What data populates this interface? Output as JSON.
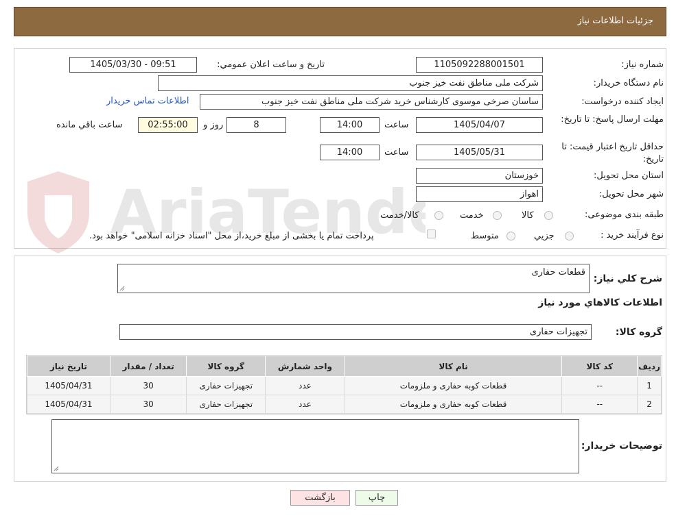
{
  "header": {
    "title": "جزئیات اطلاعات نیاز"
  },
  "fields": {
    "need_number_label": "شماره نیاز:",
    "need_number": "1105092288001501",
    "announce_label": "تاریخ و ساعت اعلان عمومي:",
    "announce_value": "1405/03/30 - 09:51",
    "buyer_label": "نام دستگاه خريدار:",
    "buyer_value": "شرکت ملی مناطق نفت خیز جنوب",
    "creator_label": "ايجاد کننده درخواست:",
    "creator_value": "ساسان صرخی موسوی کارشناس خرید  شرکت ملی مناطق نفت خیز جنوب",
    "contact_link": "اطلاعات تماس خريدار",
    "reply_deadline_label": "مهلت ارسال پاسخ: تا تاريخ:",
    "reply_date": "1405/04/07",
    "time_label": "ساعت",
    "reply_time": "14:00",
    "days_value": "8",
    "days_label": "روز و",
    "remaining_value": "02:55:00",
    "remaining_label": "ساعت باقي مانده",
    "validity_label": "حداقل تاريخ اعتبار قيمت: تا تاريخ:",
    "validity_date": "1405/05/31",
    "validity_time": "14:00",
    "province_label": "استان محل تحويل:",
    "province_value": "خوزستان",
    "city_label": "شهر محل تحويل:",
    "city_value": "اهواز",
    "category_label": "طبقه بندی موضوعی:",
    "category_options": [
      "کالا",
      "خدمت",
      "کالا/خدمت"
    ],
    "process_label": "نوع فرآيند خريد :",
    "process_options": [
      "جزيي",
      "متوسط"
    ],
    "payment_note": "پرداخت تمام يا بخشی از مبلغ خريد،از محل \"اسناد خزانه اسلامی\" خواهد بود."
  },
  "details": {
    "general_desc_label": "شرح کلي نياز:",
    "general_desc_value": "قطعات حفاری",
    "goods_info_title": "اطلاعات کالاهاي مورد نياز",
    "goods_group_label": "گروه کالا:",
    "goods_group_value": "تجهیزات حفاری",
    "table": {
      "headers": [
        "رديف",
        "کد کالا",
        "نام کالا",
        "واحد شمارش",
        "گروه کالا",
        "تعداد / مقدار",
        "تاريخ نياز"
      ],
      "rows": [
        [
          "1",
          "--",
          "قطعات کوبه حفاری و ملزومات",
          "عدد",
          "تجهیزات حفاری",
          "30",
          "1405/04/31"
        ],
        [
          "2",
          "--",
          "قطعات کوبه حفاری و ملزومات",
          "عدد",
          "تجهیزات حفاری",
          "30",
          "1405/04/31"
        ]
      ]
    },
    "buyer_notes_label": "توضيحات خريدار:"
  },
  "buttons": {
    "print": "چاپ",
    "back": "بازگشت"
  },
  "colors": {
    "header": "#8d6a3f",
    "back_button": "#fde3e3",
    "print_button": "#eefbe8",
    "link": "#2255cc"
  }
}
